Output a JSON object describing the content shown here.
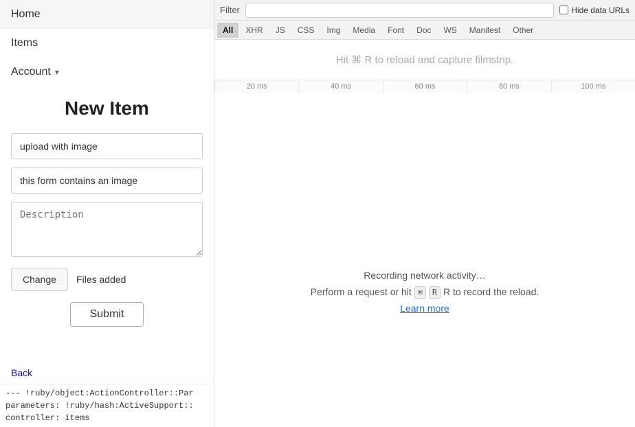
{
  "nav": {
    "home_label": "Home",
    "items_label": "Items",
    "account_label": "Account",
    "account_caret": "▾"
  },
  "form": {
    "title": "New Item",
    "name_value": "upload with image",
    "name_placeholder": "",
    "subtitle_value": "this form contains an image",
    "subtitle_placeholder": "",
    "description_placeholder": "Description",
    "change_button": "Change",
    "files_added_label": "Files added",
    "submit_button": "Submit"
  },
  "back": {
    "label": "Back"
  },
  "console": {
    "line1": "--- !ruby/object:ActionController::Par",
    "line2": "parameters: !ruby/hash:ActiveSupport::",
    "line3": "  controller: items"
  },
  "devtools": {
    "filter_label": "Filter",
    "filter_placeholder": "",
    "hide_data_urls_label": "Hide data URLs",
    "tabs": [
      "All",
      "XHR",
      "JS",
      "CSS",
      "Img",
      "Media",
      "Font",
      "Doc",
      "WS",
      "Manifest",
      "Other"
    ],
    "active_tab": "All",
    "filmstrip_msg": "Hit ⌘ R to reload and capture filmstrip.",
    "ruler_marks": [
      "20 ms",
      "40 ms",
      "60 ms",
      "80 ms",
      "100 ms"
    ],
    "recording_text": "Recording network activity…",
    "perform_text": "Perform a request or hit",
    "perform_text2": "R to record the reload.",
    "learn_more_label": "Learn more"
  }
}
